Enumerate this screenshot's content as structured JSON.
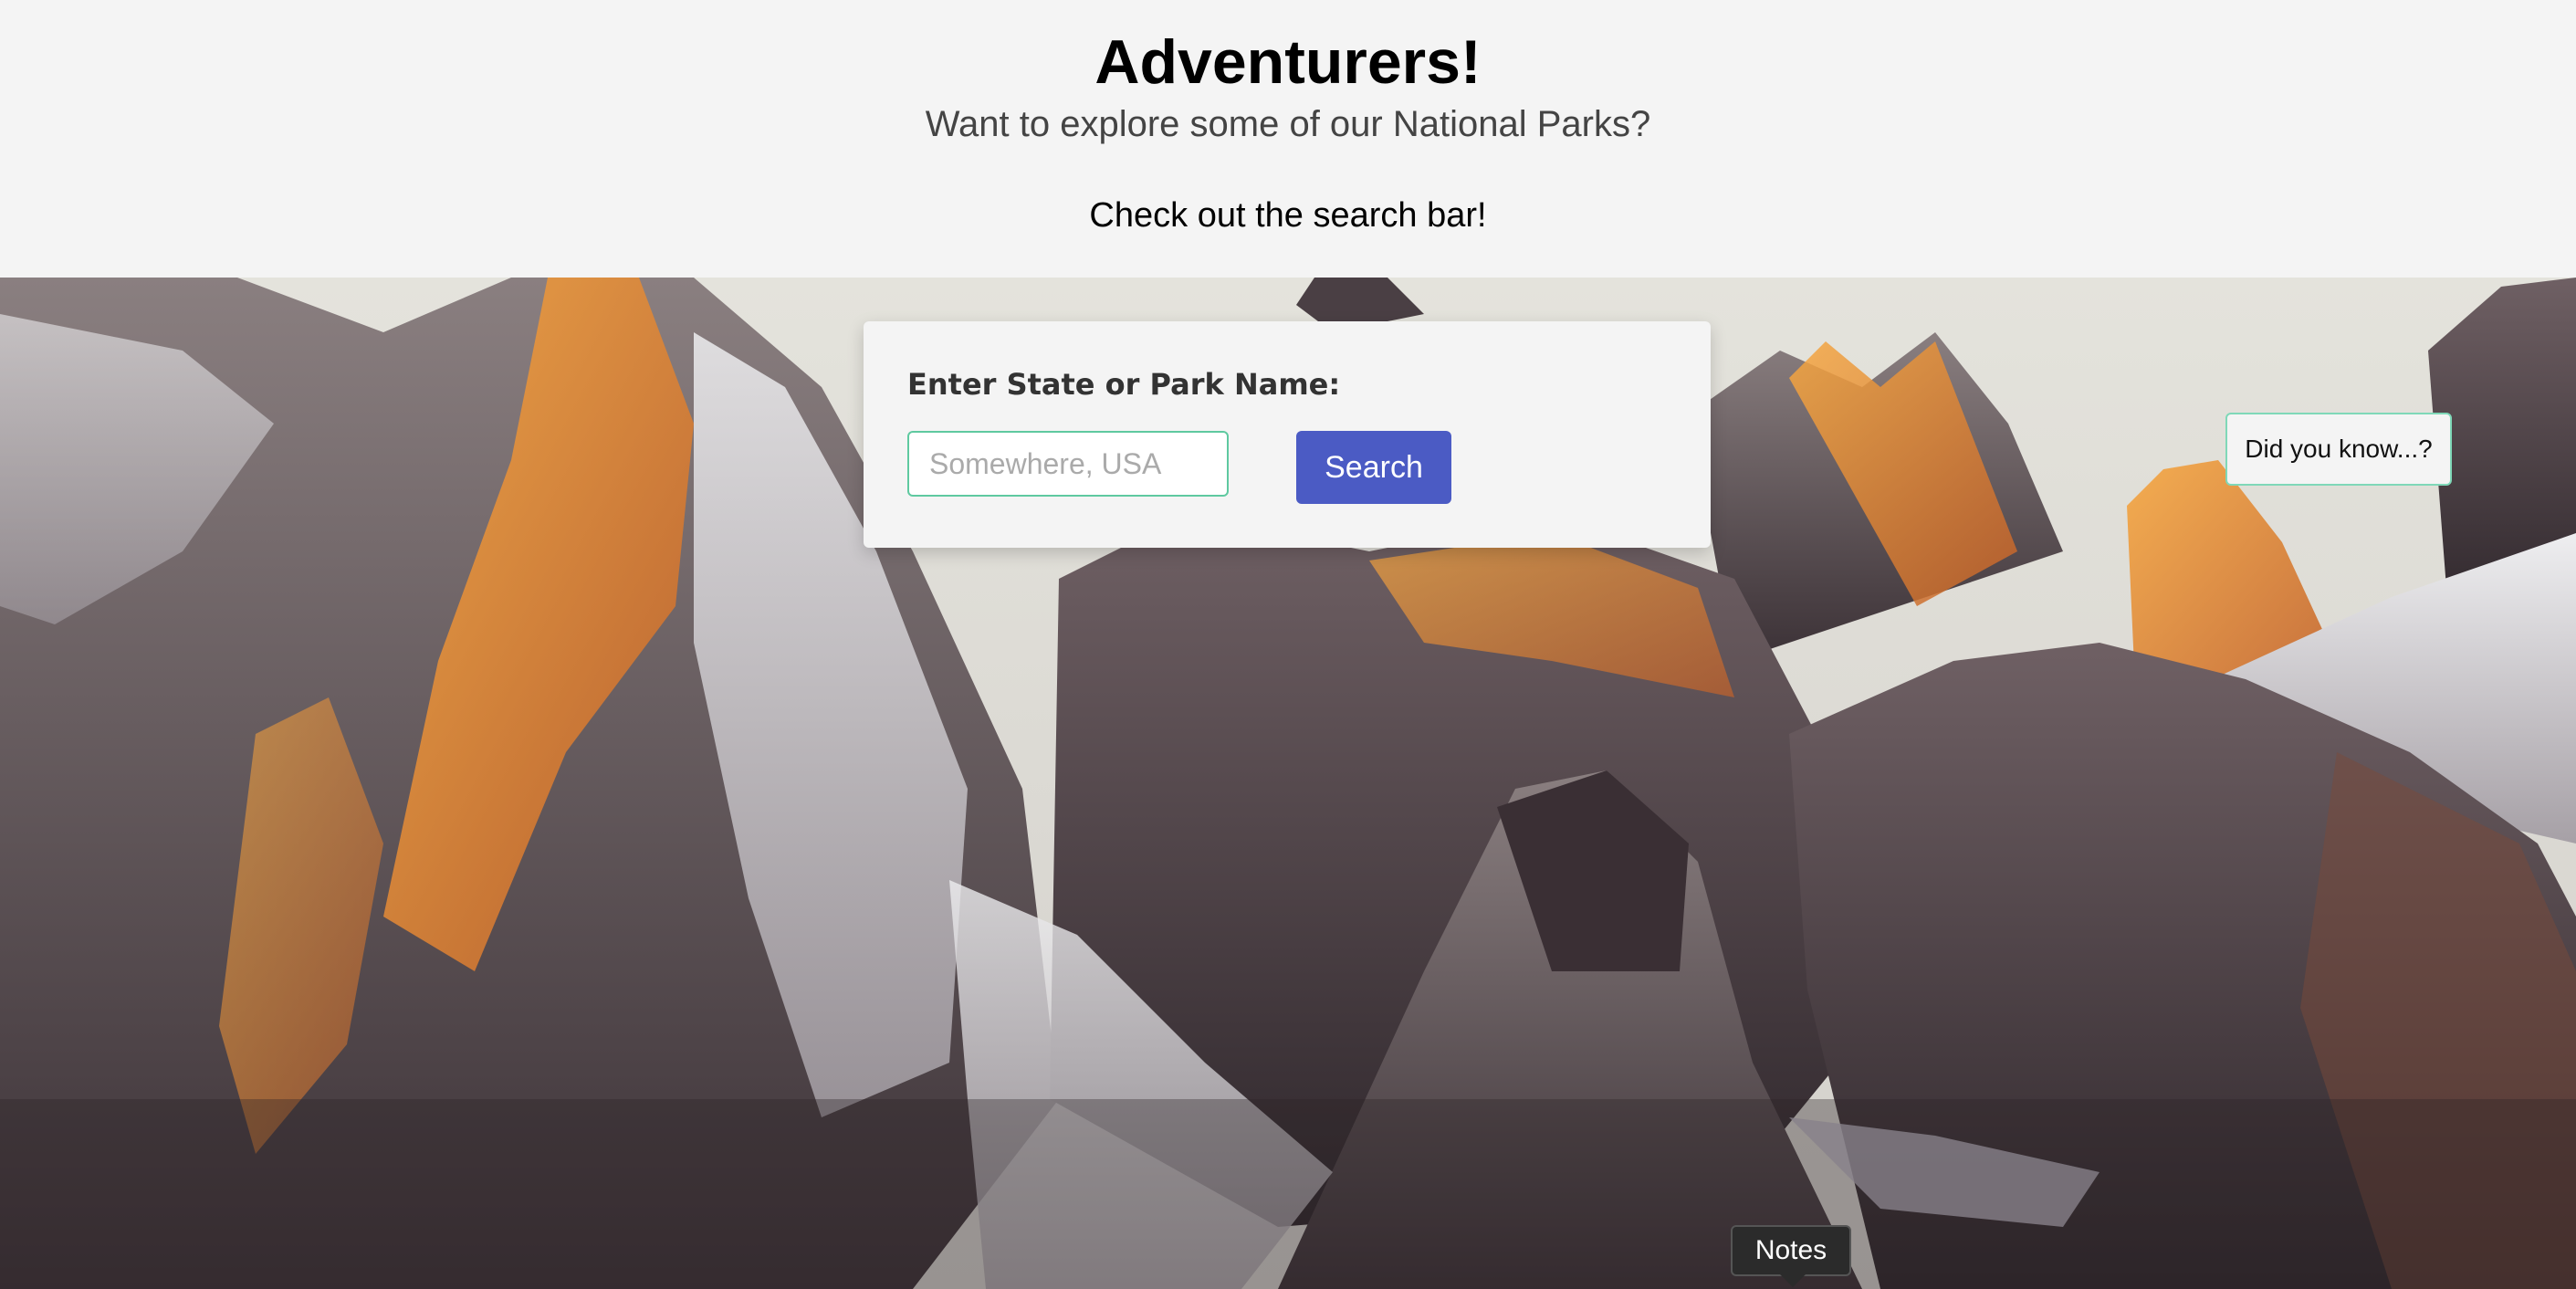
{
  "header": {
    "title": "Adventurers!",
    "subtitle": "Want to explore some of our National Parks?",
    "tagline": "Check out the search bar!"
  },
  "search": {
    "label": "Enter State or Park Name:",
    "placeholder": "Somewhere, USA",
    "value": "",
    "button_label": "Search"
  },
  "sidebar_widget": {
    "label": "Did you know...?"
  },
  "notes": {
    "label": "Notes"
  },
  "colors": {
    "header_bg": "#f4f4f4",
    "button_bg": "#4b5bc4",
    "input_border": "#5fc9a0",
    "widget_border": "#7fd8b8"
  }
}
